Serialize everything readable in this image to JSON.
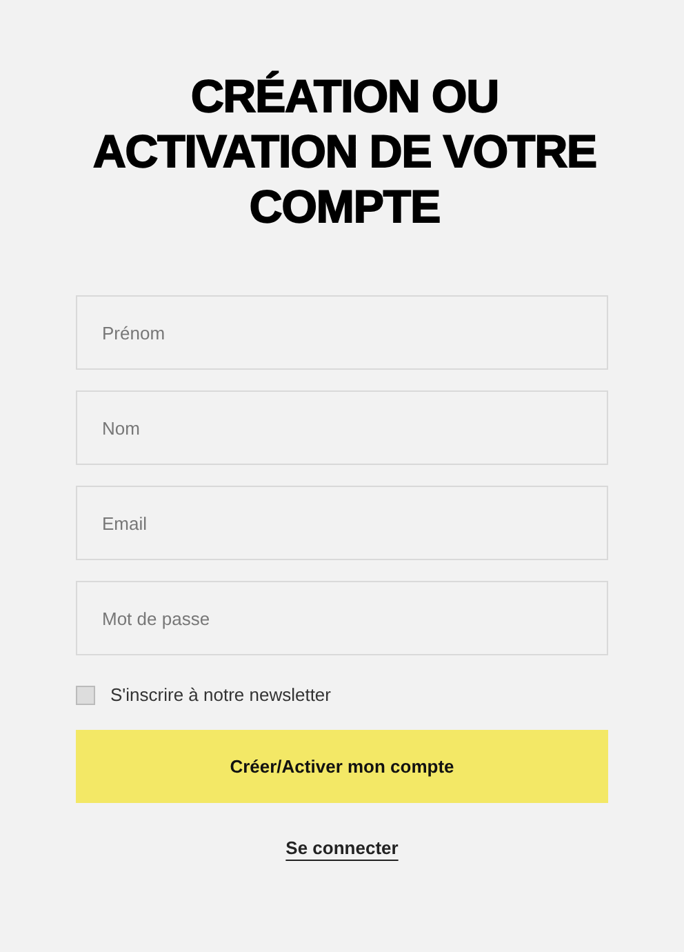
{
  "title": "CRÉATION OU ACTIVATION DE VOTRE COMPTE",
  "fields": [
    {
      "placeholder": "Prénom"
    },
    {
      "placeholder": "Nom"
    },
    {
      "placeholder": "Email"
    },
    {
      "placeholder": "Mot de passe"
    }
  ],
  "newsletter": {
    "label": "S'inscrire à notre newsletter",
    "checked": false
  },
  "submit": "Créer/Activer mon compte",
  "login_link": "Se connecter"
}
